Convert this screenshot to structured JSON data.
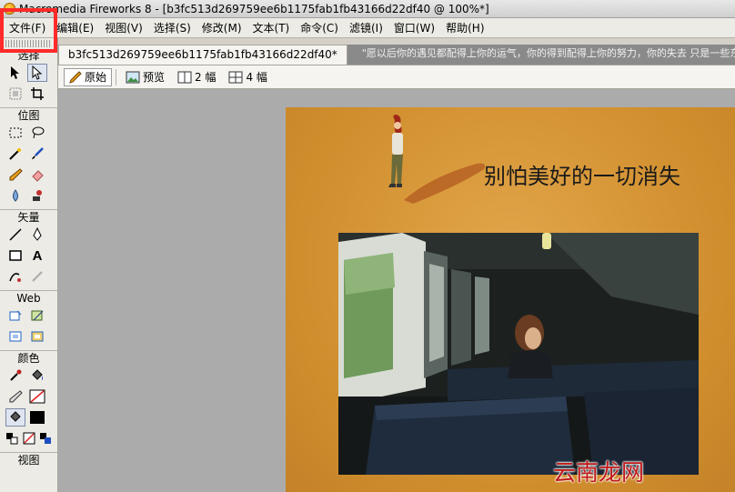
{
  "window": {
    "title": "Macromedia Fireworks 8 - [b3fc513d269759ee6b1175fab1fb43166d22df40 @ 100%*]"
  },
  "menubar": {
    "items": [
      "文件(F)",
      "编辑(E)",
      "视图(V)",
      "选择(S)",
      "修改(M)",
      "文本(T)",
      "命令(C)",
      "滤镜(I)",
      "窗口(W)",
      "帮助(H)"
    ]
  },
  "toolbar": {
    "select_title": "选择",
    "bitmap_title": "位图",
    "vector_title": "矢量",
    "web_title": "Web",
    "colors_title": "颜色",
    "view_title": "视图"
  },
  "document": {
    "tab_label": "b3fc513d269759ee6b1175fab1fb43166d22df40*",
    "tab_hint": "\"愿以后你的遇见都配得上你的运气，你的得到配得上你的努力，你的失去 只是一些东",
    "view_modes": {
      "original": "原始",
      "preview": "预览",
      "two_up": "2 幅",
      "four_up": "4 幅"
    }
  },
  "canvas": {
    "title_text": "别怕美好的一切消失"
  },
  "watermark": "云南龙网",
  "colors": {
    "highlight": "#ff2a2a",
    "canvas_bg": "#d7963a",
    "watermark": "#c01818"
  }
}
